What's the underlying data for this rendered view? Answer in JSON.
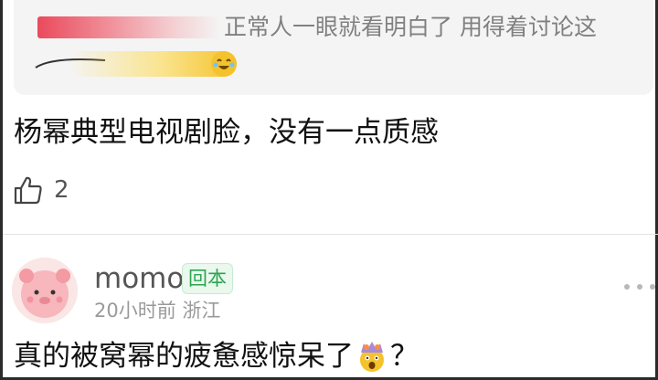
{
  "quoted_comment": {
    "text": "正常人一眼就看明白了 用得着讨论这",
    "emoji_name": "laugh-cry-icon"
  },
  "comment": {
    "text": "杨幂典型电视剧脸，没有一点质感",
    "like_count": "2"
  },
  "reply": {
    "username": "momo",
    "badge": "回本",
    "time_location": "20小时前 浙江",
    "text_before": "真的被窝幂的疲惫感惊呆了",
    "text_after": "？",
    "emoji_name": "exploding-head-icon"
  },
  "colors": {
    "badge_green": "#2fa551",
    "redaction_red": "#ea4a5c",
    "emoji_yellow": "#f5c22b"
  }
}
